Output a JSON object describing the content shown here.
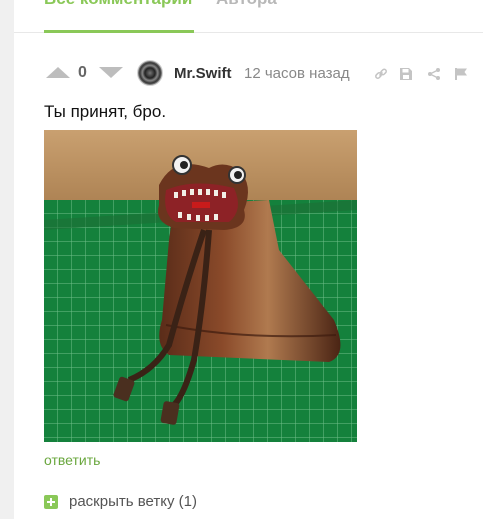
{
  "tabs": {
    "all_comments": "Все комментарии",
    "author": "Автора"
  },
  "comment": {
    "rating": "0",
    "username": "Mr.Swift",
    "time": "12 часов назад",
    "text": "Ты принят, бро.",
    "reply_label": "ответить",
    "expand_label": "раскрыть ветку (1)"
  },
  "icons": {
    "vote_up": "triangle-up",
    "vote_down": "triangle-down",
    "link": "link-icon",
    "save": "floppy-icon",
    "share": "share-icon",
    "flag": "flag-icon",
    "expand": "plus-square-icon"
  },
  "colors": {
    "accent": "#8ac858",
    "link": "#6aa73e",
    "muted": "#888888"
  }
}
